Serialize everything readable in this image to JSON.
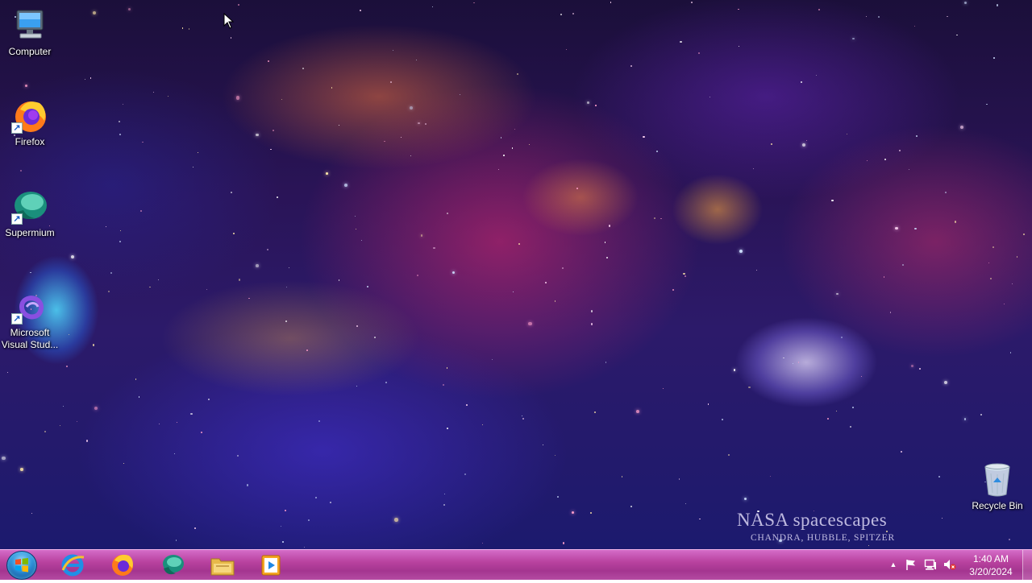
{
  "desktop": {
    "icons": [
      {
        "label": "Computer",
        "icon": "computer-icon"
      },
      {
        "label": "Firefox",
        "icon": "firefox-icon",
        "shortcut": true
      },
      {
        "label": "Supermium",
        "icon": "supermium-icon",
        "shortcut": true
      },
      {
        "label": "Microsoft Visual Stud...",
        "icon": "visual-studio-icon",
        "shortcut": true
      },
      {
        "label": "Recycle Bin",
        "icon": "recycle-bin-icon"
      }
    ],
    "wallpaper_title": "NASA spacescapes",
    "wallpaper_subtitle": "CHANDRA, HUBBLE, SPITZER"
  },
  "taskbar": {
    "start_icon": "windows-logo-icon",
    "pinned": [
      {
        "icon": "internet-explorer-icon"
      },
      {
        "icon": "firefox-icon"
      },
      {
        "icon": "supermium-icon"
      },
      {
        "icon": "file-explorer-icon"
      },
      {
        "icon": "media-player-icon"
      }
    ],
    "tray": [
      {
        "icon": "show-hidden-icons-chevron-icon",
        "glyph": "▲"
      },
      {
        "icon": "action-center-flag-icon"
      },
      {
        "icon": "network-icon"
      },
      {
        "icon": "volume-muted-icon"
      }
    ],
    "clock": {
      "time": "1:40 AM",
      "date": "3/20/2024"
    }
  }
}
